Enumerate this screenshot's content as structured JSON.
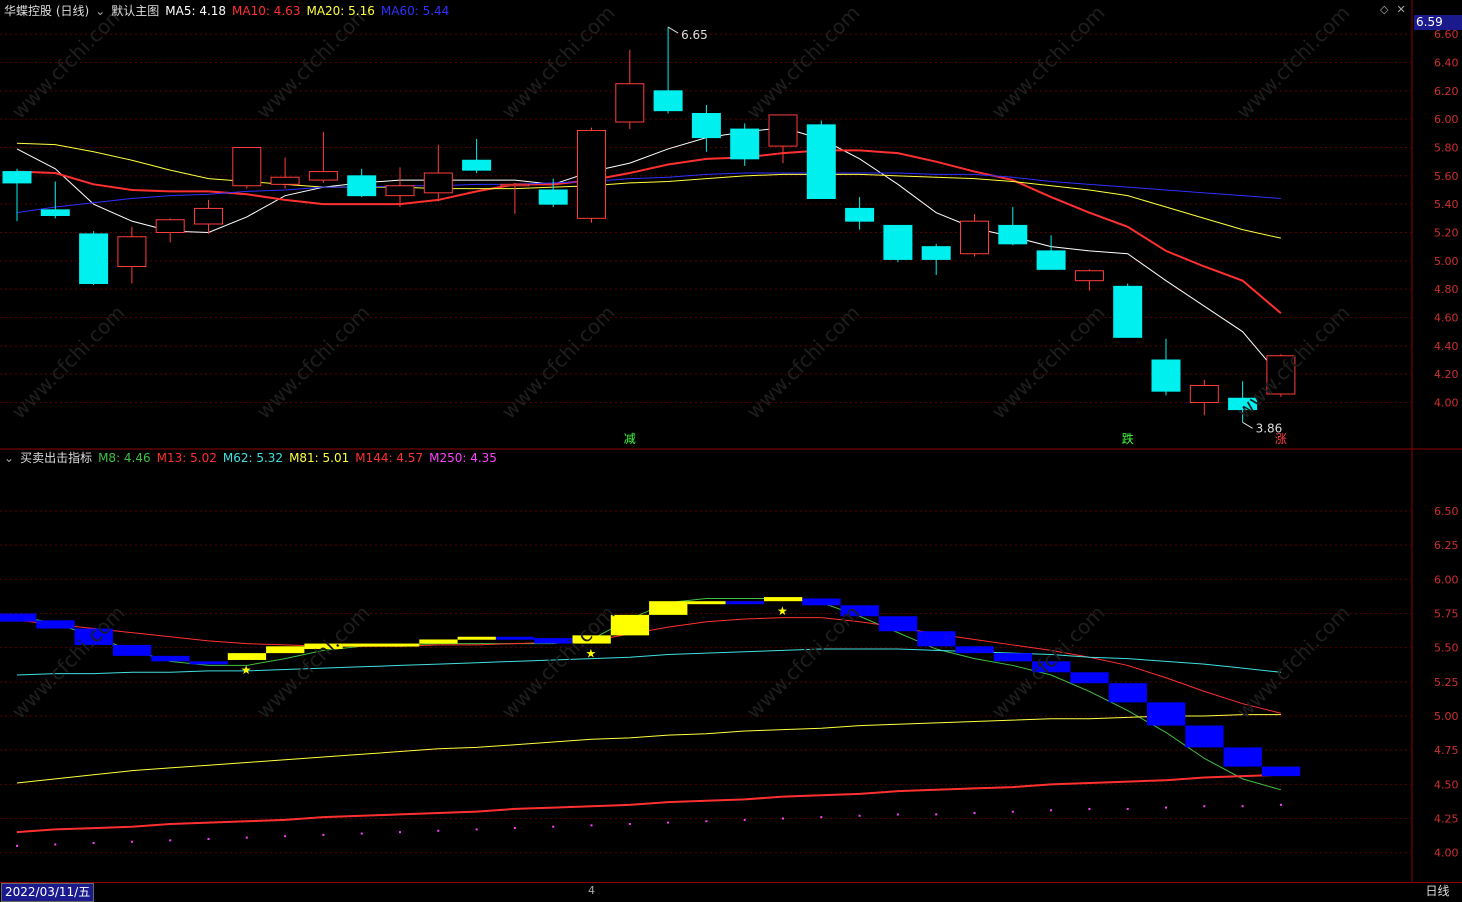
{
  "main": {
    "title": "华蝶控股 (日线)",
    "template": "默认主图",
    "ma": [
      {
        "label": "MA5: 4.18",
        "color": "#ffffff"
      },
      {
        "label": "MA10: 4.63",
        "color": "#ff3030"
      },
      {
        "label": "MA20: 5.16",
        "color": "#ffff40"
      },
      {
        "label": "MA60: 5.44",
        "color": "#3030ff"
      }
    ],
    "current_price": "6.59",
    "high_label": "6.65",
    "low_label": "3.86",
    "markers": [
      {
        "label": "减",
        "color": "#40ff40",
        "index": 16
      },
      {
        "label": "跌",
        "color": "#40ff40",
        "index": 29
      },
      {
        "label": "涨",
        "color": "#ff4040",
        "index": 33
      }
    ]
  },
  "sub": {
    "title": "买卖出击指标",
    "ma": [
      {
        "label": "M8: 4.46",
        "color": "#40c040"
      },
      {
        "label": "M13: 5.02",
        "color": "#ff3030"
      },
      {
        "label": "M62: 5.32",
        "color": "#40e0e0"
      },
      {
        "label": "M81: 5.01",
        "color": "#ffff40"
      },
      {
        "label": "M144: 4.57",
        "color": "#ff3030"
      },
      {
        "label": "M250: 4.35",
        "color": "#ff40ff"
      }
    ]
  },
  "footer": {
    "date": "2022/03/11/五",
    "month_mark": "4",
    "period": "日线"
  },
  "icons": {
    "collapse": "chevron-down-icon",
    "diamond": "diamond-icon",
    "close": "close-icon"
  },
  "watermark": "www.cfchi.com",
  "chart_data": [
    {
      "type": "candlestick",
      "title": "华蝶控股 (日线)",
      "ylim": [
        3.7,
        6.7
      ],
      "yticks": [
        4.0,
        4.2,
        4.4,
        4.6,
        4.8,
        5.0,
        5.2,
        5.4,
        5.6,
        5.8,
        6.0,
        6.2,
        6.4,
        6.6
      ],
      "candles": [
        {
          "o": 5.63,
          "h": 5.65,
          "l": 5.28,
          "c": 5.55
        },
        {
          "o": 5.36,
          "h": 5.56,
          "l": 5.3,
          "c": 5.32
        },
        {
          "o": 5.19,
          "h": 5.21,
          "l": 4.83,
          "c": 4.84
        },
        {
          "o": 4.96,
          "h": 5.24,
          "l": 4.84,
          "c": 5.17
        },
        {
          "o": 5.2,
          "h": 5.3,
          "l": 5.13,
          "c": 5.29
        },
        {
          "o": 5.26,
          "h": 5.43,
          "l": 5.19,
          "c": 5.37
        },
        {
          "o": 5.53,
          "h": 5.8,
          "l": 5.51,
          "c": 5.8
        },
        {
          "o": 5.54,
          "h": 5.73,
          "l": 5.51,
          "c": 5.59
        },
        {
          "o": 5.57,
          "h": 5.91,
          "l": 5.55,
          "c": 5.63
        },
        {
          "o": 5.6,
          "h": 5.65,
          "l": 5.45,
          "c": 5.46
        },
        {
          "o": 5.46,
          "h": 5.66,
          "l": 5.38,
          "c": 5.53
        },
        {
          "o": 5.48,
          "h": 5.82,
          "l": 5.42,
          "c": 5.62
        },
        {
          "o": 5.71,
          "h": 5.86,
          "l": 5.62,
          "c": 5.64
        },
        {
          "o": 5.53,
          "h": 5.55,
          "l": 5.33,
          "c": 5.54
        },
        {
          "o": 5.5,
          "h": 5.58,
          "l": 5.38,
          "c": 5.4
        },
        {
          "o": 5.3,
          "h": 5.94,
          "l": 5.27,
          "c": 5.92
        },
        {
          "o": 5.98,
          "h": 6.49,
          "l": 5.93,
          "c": 6.25
        },
        {
          "o": 6.2,
          "h": 6.65,
          "l": 6.04,
          "c": 6.06
        },
        {
          "o": 6.04,
          "h": 6.1,
          "l": 5.77,
          "c": 5.87
        },
        {
          "o": 5.93,
          "h": 5.97,
          "l": 5.67,
          "c": 5.72
        },
        {
          "o": 5.81,
          "h": 6.03,
          "l": 5.69,
          "c": 6.03
        },
        {
          "o": 5.96,
          "h": 5.99,
          "l": 5.44,
          "c": 5.44
        },
        {
          "o": 5.37,
          "h": 5.45,
          "l": 5.22,
          "c": 5.28
        },
        {
          "o": 5.25,
          "h": 5.25,
          "l": 4.99,
          "c": 5.01
        },
        {
          "o": 5.1,
          "h": 5.12,
          "l": 4.9,
          "c": 5.01
        },
        {
          "o": 5.05,
          "h": 5.33,
          "l": 5.03,
          "c": 5.28
        },
        {
          "o": 5.25,
          "h": 5.38,
          "l": 5.11,
          "c": 5.12
        },
        {
          "o": 5.07,
          "h": 5.18,
          "l": 4.95,
          "c": 4.94
        },
        {
          "o": 4.86,
          "h": 4.94,
          "l": 4.79,
          "c": 4.93
        },
        {
          "o": 4.82,
          "h": 4.84,
          "l": 4.46,
          "c": 4.46
        },
        {
          "o": 4.3,
          "h": 4.45,
          "l": 4.05,
          "c": 4.08
        },
        {
          "o": 4.0,
          "h": 4.16,
          "l": 3.91,
          "c": 4.12
        },
        {
          "o": 4.03,
          "h": 4.15,
          "l": 3.86,
          "c": 3.95
        },
        {
          "o": 4.06,
          "h": 4.34,
          "l": 4.04,
          "c": 4.33
        }
      ],
      "series": [
        {
          "name": "MA5",
          "color": "#ffffff",
          "values": [
            5.79,
            5.65,
            5.4,
            5.28,
            5.21,
            5.2,
            5.31,
            5.46,
            5.52,
            5.55,
            5.57,
            5.57,
            5.57,
            5.57,
            5.54,
            5.63,
            5.69,
            5.79,
            5.87,
            5.91,
            5.94,
            5.86,
            5.72,
            5.54,
            5.34,
            5.23,
            5.17,
            5.1,
            5.07,
            5.05,
            4.86,
            4.68,
            4.5,
            4.18
          ]
        },
        {
          "name": "MA10",
          "color": "#ff3030",
          "values": [
            5.63,
            5.62,
            5.54,
            5.5,
            5.49,
            5.49,
            5.47,
            5.43,
            5.4,
            5.4,
            5.4,
            5.43,
            5.49,
            5.54,
            5.54,
            5.57,
            5.62,
            5.68,
            5.72,
            5.73,
            5.76,
            5.78,
            5.78,
            5.76,
            5.7,
            5.63,
            5.57,
            5.45,
            5.34,
            5.24,
            5.07,
            4.96,
            4.86,
            4.63
          ]
        },
        {
          "name": "MA20",
          "color": "#ffff40",
          "values": [
            5.83,
            5.82,
            5.77,
            5.71,
            5.64,
            5.58,
            5.56,
            5.54,
            5.52,
            5.52,
            5.52,
            5.51,
            5.51,
            5.51,
            5.52,
            5.53,
            5.55,
            5.56,
            5.58,
            5.6,
            5.61,
            5.61,
            5.61,
            5.6,
            5.59,
            5.58,
            5.56,
            5.53,
            5.5,
            5.46,
            5.38,
            5.3,
            5.22,
            5.16
          ]
        },
        {
          "name": "MA60",
          "color": "#3030ff",
          "values": [
            5.34,
            5.38,
            5.41,
            5.44,
            5.46,
            5.47,
            5.49,
            5.5,
            5.52,
            5.52,
            5.53,
            5.53,
            5.54,
            5.54,
            5.55,
            5.56,
            5.58,
            5.59,
            5.61,
            5.62,
            5.62,
            5.62,
            5.62,
            5.62,
            5.61,
            5.61,
            5.59,
            5.56,
            5.54,
            5.52,
            5.5,
            5.48,
            5.46,
            5.44
          ]
        }
      ]
    },
    {
      "type": "indicator",
      "title": "买卖出击指标",
      "ylim": [
        3.8,
        6.8
      ],
      "yticks": [
        4.0,
        4.25,
        4.5,
        4.75,
        5.0,
        5.25,
        5.5,
        5.75,
        6.0,
        6.25,
        6.5
      ],
      "blocks": [
        {
          "top": 5.75,
          "bot": 5.69,
          "color": "#0000ff"
        },
        {
          "top": 5.7,
          "bot": 5.64,
          "color": "#0000ff"
        },
        {
          "top": 5.64,
          "bot": 5.52,
          "color": "#0000ff"
        },
        {
          "top": 5.52,
          "bot": 5.44,
          "color": "#0000ff"
        },
        {
          "top": 5.44,
          "bot": 5.4,
          "color": "#0000ff"
        },
        {
          "top": 5.4,
          "bot": 5.4,
          "color": "#0000ff"
        },
        {
          "top": 5.46,
          "bot": 5.41,
          "color": "#ffff00"
        },
        {
          "top": 5.51,
          "bot": 5.46,
          "color": "#ffff00"
        },
        {
          "top": 5.53,
          "bot": 5.49,
          "color": "#ffff00"
        },
        {
          "top": 5.53,
          "bot": 5.53,
          "color": "#ffff00"
        },
        {
          "top": 5.53,
          "bot": 5.53,
          "color": "#ffff00"
        },
        {
          "top": 5.56,
          "bot": 5.53,
          "color": "#ffff00"
        },
        {
          "top": 5.58,
          "bot": 5.56,
          "color": "#ffff00"
        },
        {
          "top": 5.58,
          "bot": 5.56,
          "color": "#0000ff"
        },
        {
          "top": 5.57,
          "bot": 5.53,
          "color": "#0000ff"
        },
        {
          "top": 5.59,
          "bot": 5.53,
          "color": "#ffff00"
        },
        {
          "top": 5.74,
          "bot": 5.59,
          "color": "#ffff00"
        },
        {
          "top": 5.84,
          "bot": 5.74,
          "color": "#ffff00"
        },
        {
          "top": 5.84,
          "bot": 5.82,
          "color": "#ffff00"
        },
        {
          "top": 5.84,
          "bot": 5.83,
          "color": "#0000ff"
        },
        {
          "top": 5.87,
          "bot": 5.84,
          "color": "#ffff00"
        },
        {
          "top": 5.86,
          "bot": 5.81,
          "color": "#0000ff"
        },
        {
          "top": 5.81,
          "bot": 5.73,
          "color": "#0000ff"
        },
        {
          "top": 5.73,
          "bot": 5.62,
          "color": "#0000ff"
        },
        {
          "top": 5.62,
          "bot": 5.51,
          "color": "#0000ff"
        },
        {
          "top": 5.51,
          "bot": 5.46,
          "color": "#0000ff"
        },
        {
          "top": 5.46,
          "bot": 5.4,
          "color": "#0000ff"
        },
        {
          "top": 5.4,
          "bot": 5.32,
          "color": "#0000ff"
        },
        {
          "top": 5.32,
          "bot": 5.24,
          "color": "#0000ff"
        },
        {
          "top": 5.24,
          "bot": 5.1,
          "color": "#0000ff"
        },
        {
          "top": 5.1,
          "bot": 4.93,
          "color": "#0000ff"
        },
        {
          "top": 4.93,
          "bot": 4.77,
          "color": "#0000ff"
        },
        {
          "top": 4.77,
          "bot": 4.63,
          "color": "#0000ff"
        },
        {
          "top": 4.63,
          "bot": 4.56,
          "color": "#0000ff"
        }
      ],
      "stars": [
        6,
        15,
        20
      ],
      "series": [
        {
          "name": "M8",
          "color": "#40c040",
          "values": [
            5.73,
            5.68,
            5.58,
            5.48,
            5.4,
            5.37,
            5.37,
            5.42,
            5.48,
            5.51,
            5.52,
            5.53,
            5.53,
            5.53,
            5.53,
            5.56,
            5.71,
            5.83,
            5.86,
            5.86,
            5.86,
            5.83,
            5.73,
            5.61,
            5.49,
            5.42,
            5.37,
            5.3,
            5.18,
            5.04,
            4.88,
            4.69,
            4.54,
            4.46
          ]
        },
        {
          "name": "M13",
          "color": "#ff3030",
          "values": [
            5.7,
            5.67,
            5.64,
            5.61,
            5.58,
            5.55,
            5.53,
            5.52,
            5.51,
            5.51,
            5.51,
            5.52,
            5.52,
            5.53,
            5.54,
            5.55,
            5.6,
            5.65,
            5.69,
            5.71,
            5.72,
            5.72,
            5.69,
            5.65,
            5.6,
            5.56,
            5.52,
            5.48,
            5.43,
            5.37,
            5.28,
            5.18,
            5.09,
            5.02
          ]
        },
        {
          "name": "M62",
          "color": "#40e0e0",
          "values": [
            5.3,
            5.31,
            5.31,
            5.32,
            5.32,
            5.33,
            5.33,
            5.34,
            5.35,
            5.36,
            5.37,
            5.38,
            5.39,
            5.4,
            5.41,
            5.42,
            5.43,
            5.45,
            5.46,
            5.47,
            5.48,
            5.49,
            5.49,
            5.49,
            5.48,
            5.47,
            5.46,
            5.45,
            5.43,
            5.42,
            5.4,
            5.38,
            5.35,
            5.32
          ]
        },
        {
          "name": "M81",
          "color": "#ffff40",
          "values": [
            4.51,
            4.54,
            4.57,
            4.6,
            4.62,
            4.64,
            4.66,
            4.68,
            4.7,
            4.72,
            4.74,
            4.76,
            4.77,
            4.79,
            4.81,
            4.83,
            4.84,
            4.86,
            4.87,
            4.89,
            4.9,
            4.91,
            4.93,
            4.94,
            4.95,
            4.96,
            4.97,
            4.98,
            4.98,
            4.99,
            5.0,
            5.0,
            5.01,
            5.01
          ]
        },
        {
          "name": "M144",
          "color": "#ff3030",
          "values": [
            4.15,
            4.17,
            4.18,
            4.19,
            4.21,
            4.22,
            4.23,
            4.24,
            4.26,
            4.27,
            4.28,
            4.29,
            4.3,
            4.32,
            4.33,
            4.34,
            4.35,
            4.37,
            4.38,
            4.39,
            4.41,
            4.42,
            4.43,
            4.45,
            4.46,
            4.47,
            4.48,
            4.5,
            4.51,
            4.52,
            4.53,
            4.55,
            4.56,
            4.57
          ]
        },
        {
          "name": "M250",
          "color": "#ff40ff",
          "values": [
            4.05,
            4.06,
            4.07,
            4.08,
            4.09,
            4.1,
            4.11,
            4.12,
            4.13,
            4.14,
            4.15,
            4.16,
            4.17,
            4.18,
            4.19,
            4.2,
            4.21,
            4.22,
            4.23,
            4.24,
            4.25,
            4.26,
            4.27,
            4.28,
            4.28,
            4.29,
            4.3,
            4.31,
            4.32,
            4.32,
            4.33,
            4.34,
            4.34,
            4.35
          ]
        }
      ]
    }
  ]
}
